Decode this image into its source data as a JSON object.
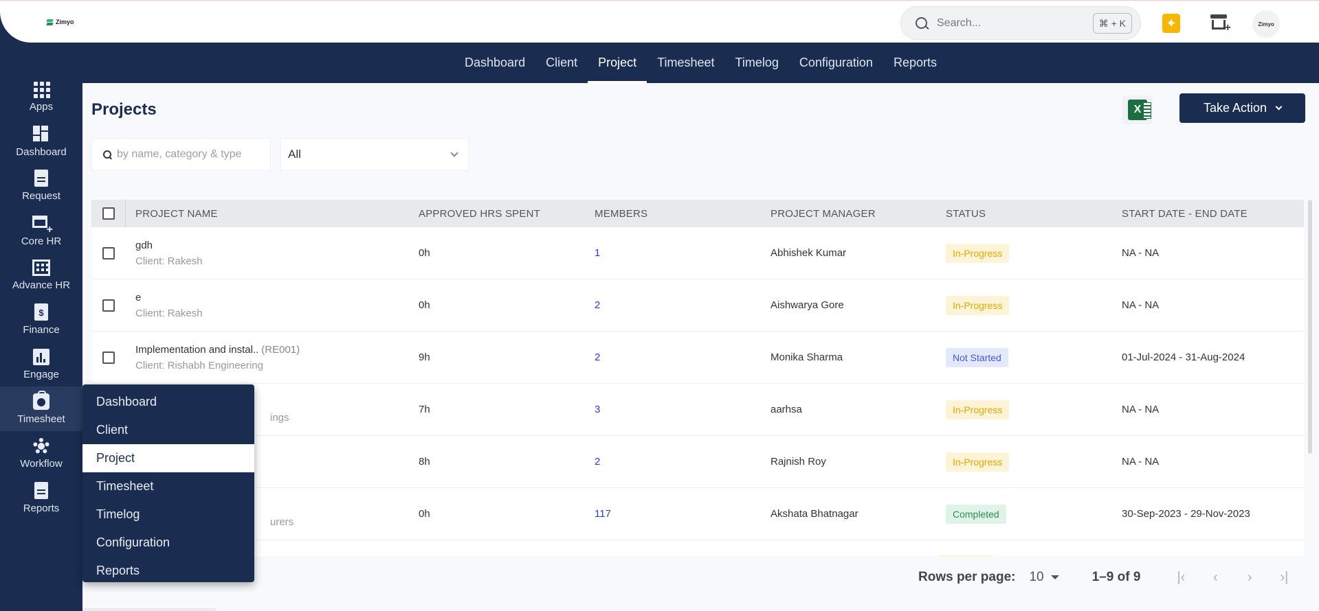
{
  "topbar": {
    "logo_text": "Zimyo",
    "search_placeholder": "Search...",
    "search_shortcut": "⌘ + K",
    "avatar_text": "Zimyo"
  },
  "module_nav": {
    "tabs": [
      {
        "label": "Dashboard",
        "active": false
      },
      {
        "label": "Client",
        "active": false
      },
      {
        "label": "Project",
        "active": true
      },
      {
        "label": "Timesheet",
        "active": false
      },
      {
        "label": "Timelog",
        "active": false
      },
      {
        "label": "Configuration",
        "active": false
      },
      {
        "label": "Reports",
        "active": false
      }
    ]
  },
  "sidebar": {
    "items": [
      {
        "label": "Apps",
        "icon": "apps-grid-icon"
      },
      {
        "label": "Dashboard",
        "icon": "dashboard-icon"
      },
      {
        "label": "Request",
        "icon": "document-icon"
      },
      {
        "label": "Core HR",
        "icon": "store-add-icon"
      },
      {
        "label": "Advance HR",
        "icon": "building-icon"
      },
      {
        "label": "Finance",
        "icon": "finance-icon"
      },
      {
        "label": "Engage",
        "icon": "chart-icon"
      },
      {
        "label": "Timesheet",
        "icon": "timesheet-bag-icon",
        "active": true
      },
      {
        "label": "Workflow",
        "icon": "gear-icon"
      },
      {
        "label": "Reports",
        "icon": "report-icon"
      }
    ]
  },
  "page": {
    "title": "Projects",
    "take_action_label": "Take Action",
    "search_placeholder": "by name, category & type",
    "filter_value": "All"
  },
  "table": {
    "headers": {
      "name": "PROJECT NAME",
      "hrs": "APPROVED HRS SPENT",
      "members": "MEMBERS",
      "manager": "PROJECT MANAGER",
      "status": "STATUS",
      "dates": "START DATE - END DATE"
    },
    "rows": [
      {
        "name": "gdh",
        "code": "",
        "client": "Client: Rakesh",
        "hrs": "0h",
        "members": "1",
        "manager": "Abhishek Kumar",
        "status": "In-Progress",
        "dates": "NA - NA"
      },
      {
        "name": "e",
        "code": "",
        "client": "Client: Rakesh",
        "hrs": "0h",
        "members": "2",
        "manager": "Aishwarya Gore",
        "status": "In-Progress",
        "dates": "NA - NA"
      },
      {
        "name": "Implementation and instal..",
        "code": "(RE001)",
        "client": "Client: Rishabh Engineering",
        "hrs": "9h",
        "members": "2",
        "manager": "Monika Sharma",
        "status": "Not Started",
        "dates": "01-Jul-2024 - 31-Aug-2024"
      },
      {
        "name": "",
        "code": "",
        "client": "ings",
        "hrs": "7h",
        "members": "3",
        "manager": "aarhsa",
        "status": "In-Progress",
        "dates": "NA - NA"
      },
      {
        "name": "",
        "code": "",
        "client": "",
        "hrs": "8h",
        "members": "2",
        "manager": "Rajnish Roy",
        "status": "In-Progress",
        "dates": "NA - NA"
      },
      {
        "name": "",
        "code": "",
        "client": "urers",
        "hrs": "0h",
        "members": "117",
        "manager": "Akshata Bhatnagar",
        "status": "Completed",
        "dates": "30-Sep-2023 - 29-Nov-2023"
      }
    ]
  },
  "pagination": {
    "rows_per_page_label": "Rows per page:",
    "rows_per_page_value": "10",
    "range": "1–9 of 9"
  },
  "flyout": {
    "items": [
      {
        "label": "Dashboard",
        "active": false
      },
      {
        "label": "Client",
        "active": false
      },
      {
        "label": "Project",
        "active": true
      },
      {
        "label": "Timesheet",
        "active": false
      },
      {
        "label": "Timelog",
        "active": false
      },
      {
        "label": "Configuration",
        "active": false
      },
      {
        "label": "Reports",
        "active": false
      }
    ]
  },
  "colors": {
    "brand_navy": "#1a2c4f",
    "accent_yellow": "#f5b700",
    "status_in_progress": "#e0a800",
    "status_not_started": "#4658d6",
    "status_completed": "#2e8b57",
    "excel_green": "#1d6f42"
  }
}
